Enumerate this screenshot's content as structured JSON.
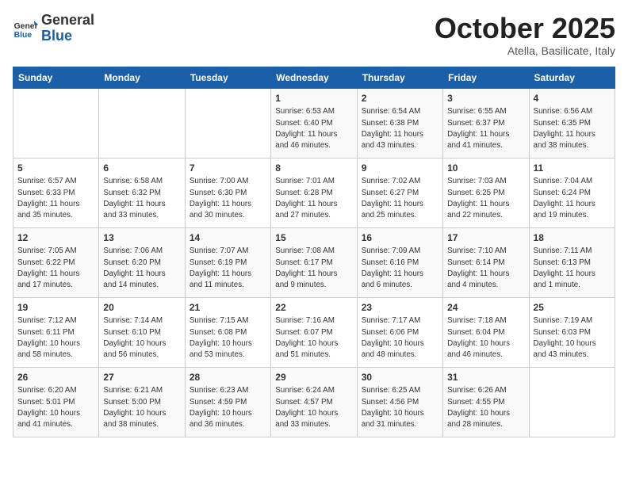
{
  "logo": {
    "general": "General",
    "blue": "Blue"
  },
  "title": "October 2025",
  "subtitle": "Atella, Basilicate, Italy",
  "days_of_week": [
    "Sunday",
    "Monday",
    "Tuesday",
    "Wednesday",
    "Thursday",
    "Friday",
    "Saturday"
  ],
  "weeks": [
    [
      {
        "day": "",
        "info": ""
      },
      {
        "day": "",
        "info": ""
      },
      {
        "day": "",
        "info": ""
      },
      {
        "day": "1",
        "info": "Sunrise: 6:53 AM\nSunset: 6:40 PM\nDaylight: 11 hours\nand 46 minutes."
      },
      {
        "day": "2",
        "info": "Sunrise: 6:54 AM\nSunset: 6:38 PM\nDaylight: 11 hours\nand 43 minutes."
      },
      {
        "day": "3",
        "info": "Sunrise: 6:55 AM\nSunset: 6:37 PM\nDaylight: 11 hours\nand 41 minutes."
      },
      {
        "day": "4",
        "info": "Sunrise: 6:56 AM\nSunset: 6:35 PM\nDaylight: 11 hours\nand 38 minutes."
      }
    ],
    [
      {
        "day": "5",
        "info": "Sunrise: 6:57 AM\nSunset: 6:33 PM\nDaylight: 11 hours\nand 35 minutes."
      },
      {
        "day": "6",
        "info": "Sunrise: 6:58 AM\nSunset: 6:32 PM\nDaylight: 11 hours\nand 33 minutes."
      },
      {
        "day": "7",
        "info": "Sunrise: 7:00 AM\nSunset: 6:30 PM\nDaylight: 11 hours\nand 30 minutes."
      },
      {
        "day": "8",
        "info": "Sunrise: 7:01 AM\nSunset: 6:28 PM\nDaylight: 11 hours\nand 27 minutes."
      },
      {
        "day": "9",
        "info": "Sunrise: 7:02 AM\nSunset: 6:27 PM\nDaylight: 11 hours\nand 25 minutes."
      },
      {
        "day": "10",
        "info": "Sunrise: 7:03 AM\nSunset: 6:25 PM\nDaylight: 11 hours\nand 22 minutes."
      },
      {
        "day": "11",
        "info": "Sunrise: 7:04 AM\nSunset: 6:24 PM\nDaylight: 11 hours\nand 19 minutes."
      }
    ],
    [
      {
        "day": "12",
        "info": "Sunrise: 7:05 AM\nSunset: 6:22 PM\nDaylight: 11 hours\nand 17 minutes."
      },
      {
        "day": "13",
        "info": "Sunrise: 7:06 AM\nSunset: 6:20 PM\nDaylight: 11 hours\nand 14 minutes."
      },
      {
        "day": "14",
        "info": "Sunrise: 7:07 AM\nSunset: 6:19 PM\nDaylight: 11 hours\nand 11 minutes."
      },
      {
        "day": "15",
        "info": "Sunrise: 7:08 AM\nSunset: 6:17 PM\nDaylight: 11 hours\nand 9 minutes."
      },
      {
        "day": "16",
        "info": "Sunrise: 7:09 AM\nSunset: 6:16 PM\nDaylight: 11 hours\nand 6 minutes."
      },
      {
        "day": "17",
        "info": "Sunrise: 7:10 AM\nSunset: 6:14 PM\nDaylight: 11 hours\nand 4 minutes."
      },
      {
        "day": "18",
        "info": "Sunrise: 7:11 AM\nSunset: 6:13 PM\nDaylight: 11 hours\nand 1 minute."
      }
    ],
    [
      {
        "day": "19",
        "info": "Sunrise: 7:12 AM\nSunset: 6:11 PM\nDaylight: 10 hours\nand 58 minutes."
      },
      {
        "day": "20",
        "info": "Sunrise: 7:14 AM\nSunset: 6:10 PM\nDaylight: 10 hours\nand 56 minutes."
      },
      {
        "day": "21",
        "info": "Sunrise: 7:15 AM\nSunset: 6:08 PM\nDaylight: 10 hours\nand 53 minutes."
      },
      {
        "day": "22",
        "info": "Sunrise: 7:16 AM\nSunset: 6:07 PM\nDaylight: 10 hours\nand 51 minutes."
      },
      {
        "day": "23",
        "info": "Sunrise: 7:17 AM\nSunset: 6:06 PM\nDaylight: 10 hours\nand 48 minutes."
      },
      {
        "day": "24",
        "info": "Sunrise: 7:18 AM\nSunset: 6:04 PM\nDaylight: 10 hours\nand 46 minutes."
      },
      {
        "day": "25",
        "info": "Sunrise: 7:19 AM\nSunset: 6:03 PM\nDaylight: 10 hours\nand 43 minutes."
      }
    ],
    [
      {
        "day": "26",
        "info": "Sunrise: 6:20 AM\nSunset: 5:01 PM\nDaylight: 10 hours\nand 41 minutes."
      },
      {
        "day": "27",
        "info": "Sunrise: 6:21 AM\nSunset: 5:00 PM\nDaylight: 10 hours\nand 38 minutes."
      },
      {
        "day": "28",
        "info": "Sunrise: 6:23 AM\nSunset: 4:59 PM\nDaylight: 10 hours\nand 36 minutes."
      },
      {
        "day": "29",
        "info": "Sunrise: 6:24 AM\nSunset: 4:57 PM\nDaylight: 10 hours\nand 33 minutes."
      },
      {
        "day": "30",
        "info": "Sunrise: 6:25 AM\nSunset: 4:56 PM\nDaylight: 10 hours\nand 31 minutes."
      },
      {
        "day": "31",
        "info": "Sunrise: 6:26 AM\nSunset: 4:55 PM\nDaylight: 10 hours\nand 28 minutes."
      },
      {
        "day": "",
        "info": ""
      }
    ]
  ]
}
